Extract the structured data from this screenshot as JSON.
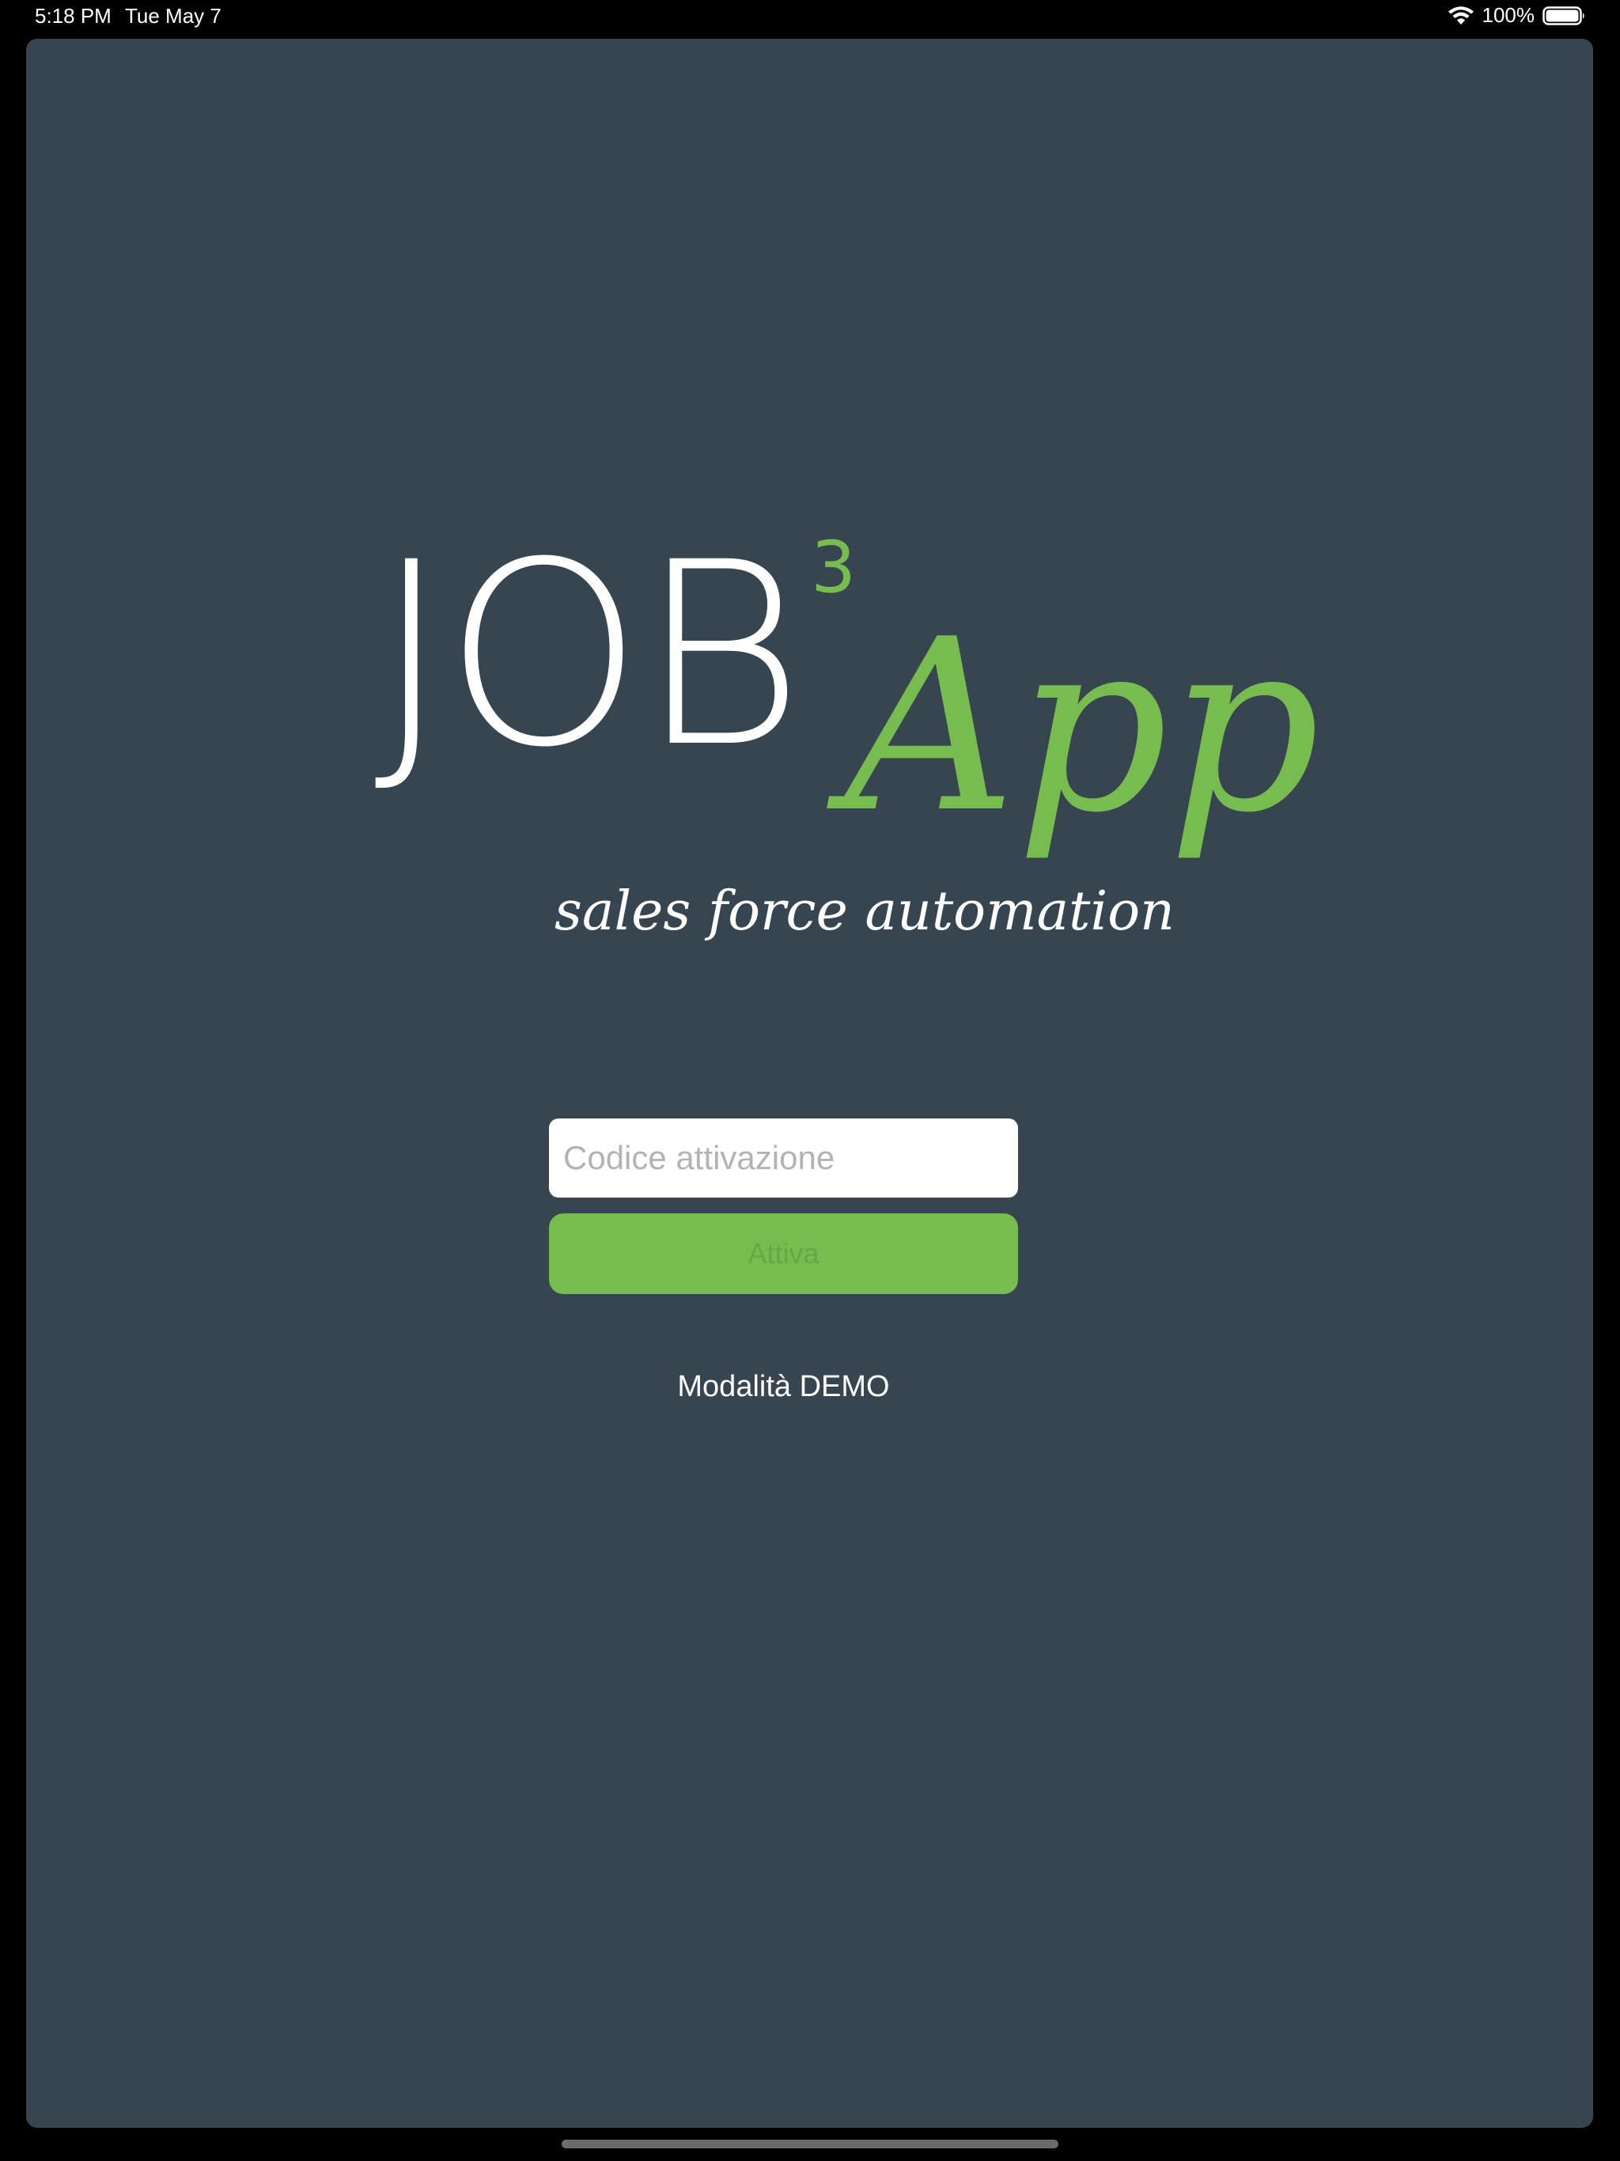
{
  "status_bar": {
    "time": "5:18 PM",
    "date": "Tue May 7",
    "battery": "100%",
    "icons": [
      "wifi-icon",
      "battery-icon"
    ]
  },
  "logo": {
    "wordmark": "JOB",
    "superscript": "3",
    "app_word": "App",
    "tagline": "sales force automation"
  },
  "activation": {
    "placeholder": "Codice attivazione",
    "value": "",
    "button_label": "Attiva"
  },
  "demo": {
    "label": "Modalità DEMO"
  },
  "colors": {
    "background": "#36454f",
    "accent": "#76bc4e",
    "text": "#ffffff"
  }
}
